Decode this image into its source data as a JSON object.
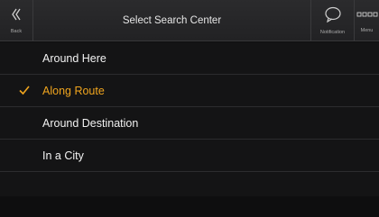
{
  "header": {
    "back_label": "Back",
    "title": "Select Search Center",
    "notification_label": "Notification",
    "menu_label": "Menu"
  },
  "options": [
    {
      "label": "Around Here",
      "selected": false
    },
    {
      "label": "Along Route",
      "selected": true
    },
    {
      "label": "Around Destination",
      "selected": false
    },
    {
      "label": "In a City",
      "selected": false
    }
  ],
  "colors": {
    "accent": "#f0a51e",
    "background": "#0e0e0f",
    "row": "#141415",
    "header": "#2b2b2d"
  }
}
